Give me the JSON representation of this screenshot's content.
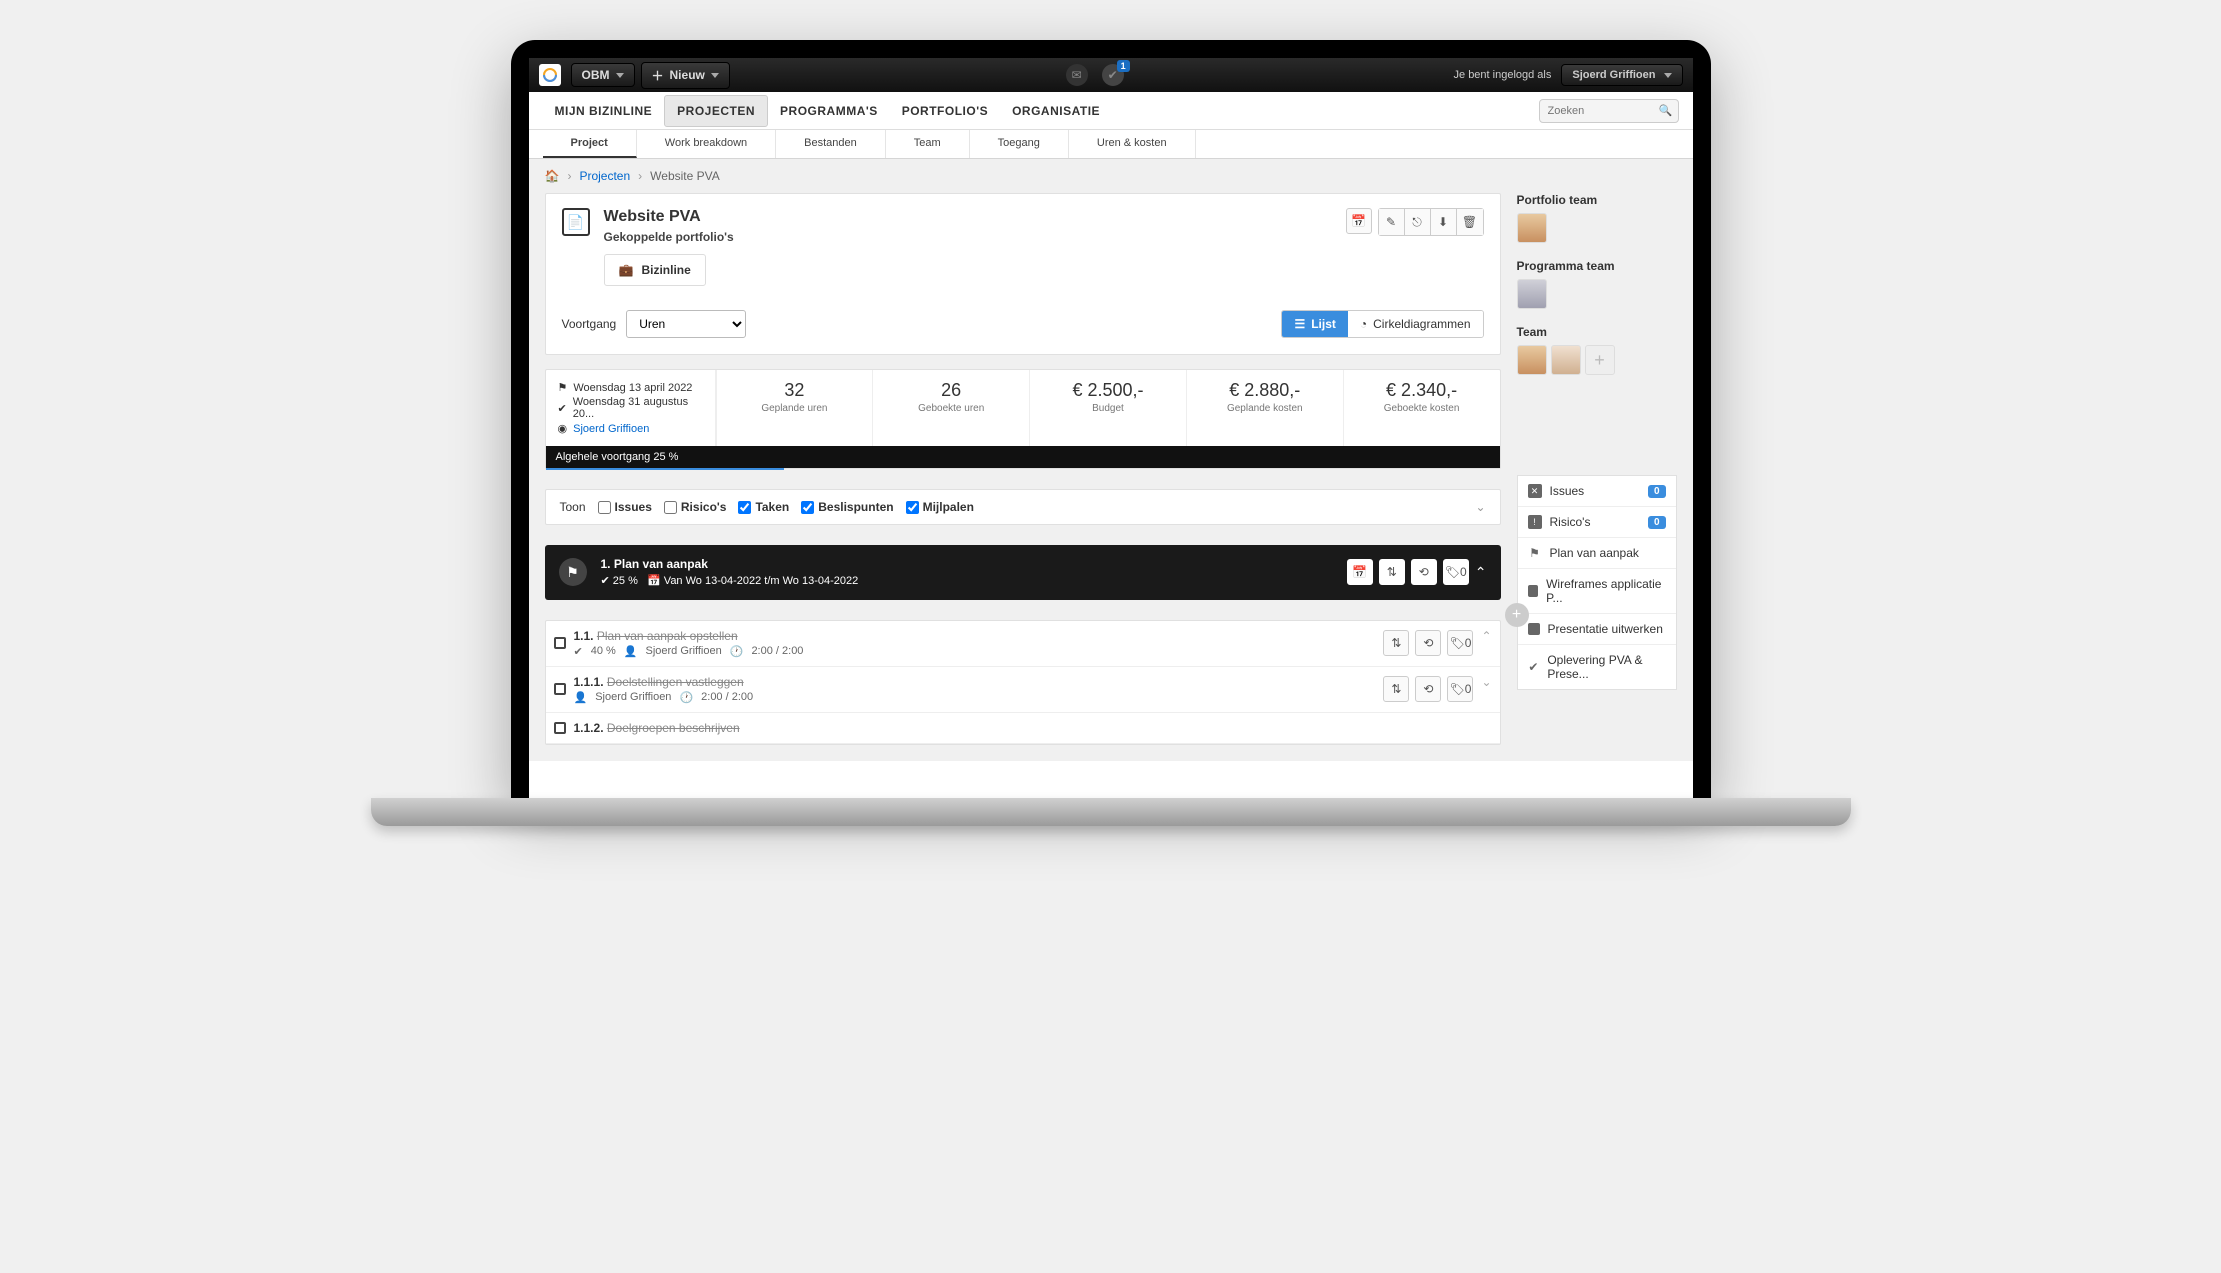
{
  "topbar": {
    "org": "OBM",
    "new_btn": "Nieuw",
    "notif_badge": "1",
    "login_text": "Je bent ingelogd als",
    "user": "Sjoerd Griffioen"
  },
  "mainnav": {
    "items": [
      "MIJN BIZINLINE",
      "PROJECTEN",
      "PROGRAMMA'S",
      "PORTFOLIO'S",
      "ORGANISATIE"
    ],
    "active_index": 1,
    "search_placeholder": "Zoeken"
  },
  "subnav": {
    "items": [
      "Project",
      "Work breakdown",
      "Bestanden",
      "Team",
      "Toegang",
      "Uren & kosten"
    ],
    "active_index": 0
  },
  "breadcrumb": {
    "link": "Projecten",
    "current": "Website PVA"
  },
  "project": {
    "title": "Website PVA",
    "subtitle": "Gekoppelde portfolio's",
    "portfolio_chip": "Bizinline"
  },
  "voortgang": {
    "label": "Voortgang",
    "selected": "Uren",
    "view_list": "Lijst",
    "view_pie": "Cirkeldiagrammen"
  },
  "meta": {
    "start": "Woensdag 13 april 2022",
    "end": "Woensdag 31 augustus 20...",
    "owner": "Sjoerd Griffioen"
  },
  "stats": [
    {
      "val": "32",
      "lbl": "Geplande uren"
    },
    {
      "val": "26",
      "lbl": "Geboekte uren"
    },
    {
      "val": "€ 2.500,-",
      "lbl": "Budget"
    },
    {
      "val": "€ 2.880,-",
      "lbl": "Geplande kosten"
    },
    {
      "val": "€ 2.340,-",
      "lbl": "Geboekte kosten"
    }
  ],
  "progress_label": "Algehele voortgang 25 %",
  "filter": {
    "label": "Toon",
    "issues": "Issues",
    "risks": "Risico's",
    "tasks": "Taken",
    "decisions": "Beslispunten",
    "milestones": "Mijlpalen"
  },
  "phase": {
    "num": "1.",
    "name": "Plan van aanpak",
    "progress": "25 %",
    "dates": "Van Wo 13-04-2022 t/m Wo 13-04-2022",
    "tag_count": "0"
  },
  "tasks": [
    {
      "num": "1.1.",
      "name": "Plan van aanpak opstellen",
      "progress": "40 %",
      "assignee": "Sjoerd Griffioen",
      "hours": "2:00 / 2:00",
      "tag_count": "0",
      "expandable": true
    },
    {
      "num": "1.1.1.",
      "name": "Doelstellingen vastleggen",
      "assignee": "Sjoerd Griffioen",
      "hours": "2:00 / 2:00",
      "tag_count": "0",
      "expandable": true
    },
    {
      "num": "1.1.2.",
      "name": "Doelgroepen beschrijven"
    }
  ],
  "sidebar": {
    "portfolio_team": "Portfolio team",
    "programma_team": "Programma team",
    "team": "Team",
    "items": [
      {
        "icon": "x",
        "label": "Issues",
        "badge": "0"
      },
      {
        "icon": "warn",
        "label": "Risico's",
        "badge": "0"
      },
      {
        "icon": "flag",
        "label": "Plan van aanpak"
      },
      {
        "icon": "sq",
        "label": "Wireframes applicatie P..."
      },
      {
        "icon": "sq",
        "label": "Presentatie uitwerken"
      },
      {
        "icon": "check",
        "label": "Oplevering PVA & Prese..."
      }
    ]
  }
}
